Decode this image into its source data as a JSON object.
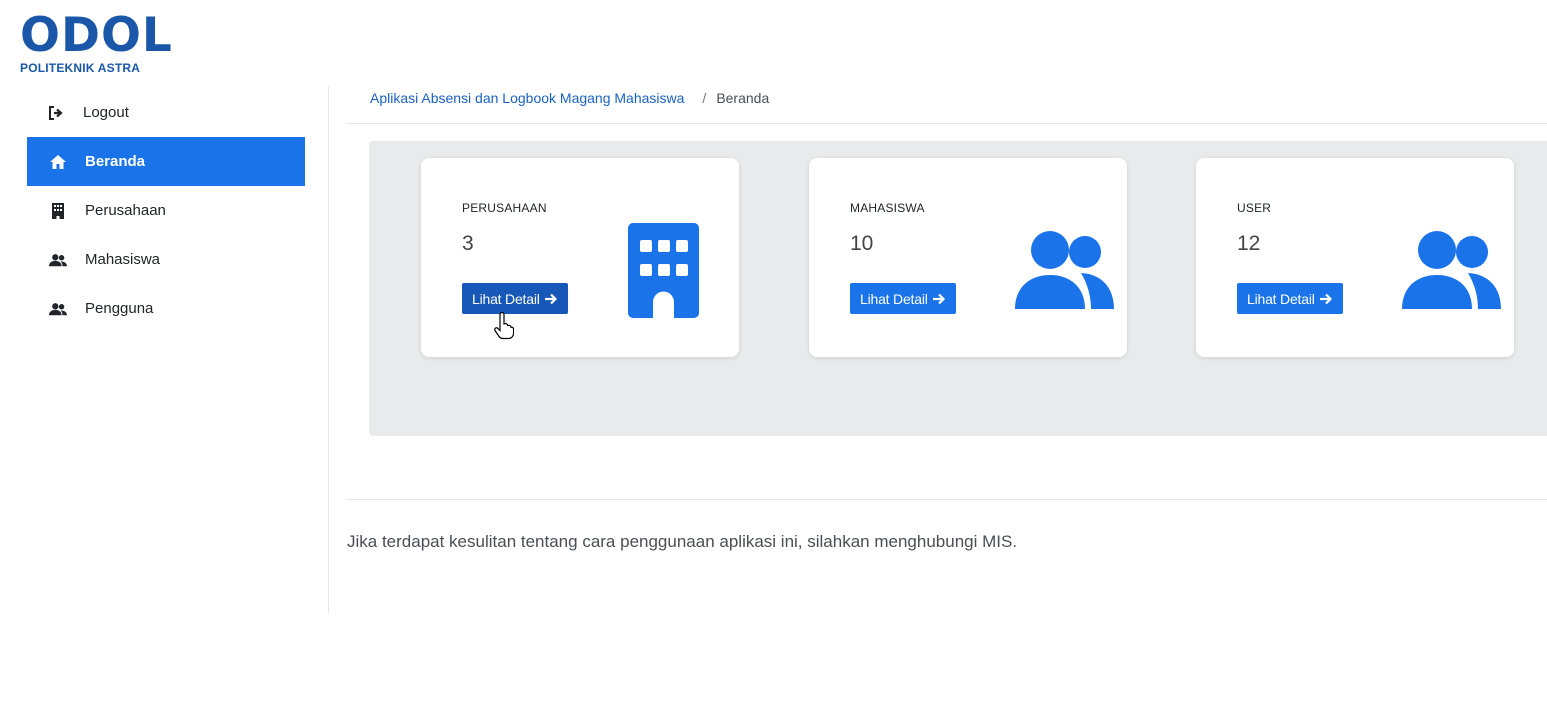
{
  "logo": {
    "title": "ODOL",
    "subtitle": "POLITEKNIK ASTRA"
  },
  "sidebar": {
    "items": [
      {
        "label": "Logout",
        "icon": "logout-icon"
      },
      {
        "label": "Beranda",
        "icon": "home-icon",
        "active": true
      },
      {
        "label": "Perusahaan",
        "icon": "building-icon"
      },
      {
        "label": "Mahasiswa",
        "icon": "users-icon"
      },
      {
        "label": "Pengguna",
        "icon": "users-icon"
      }
    ]
  },
  "breadcrumb": {
    "app": "Aplikasi Absensi dan Logbook Magang Mahasiswa",
    "separator": "/",
    "current": "Beranda"
  },
  "cards": [
    {
      "label": "PERUSAHAAN",
      "value": "3",
      "button": "Lihat Detail",
      "icon": "building-icon"
    },
    {
      "label": "MAHASISWA",
      "value": "10",
      "button": "Lihat Detail",
      "icon": "users-icon"
    },
    {
      "label": "USER",
      "value": "12",
      "button": "Lihat Detail",
      "icon": "users-icon"
    }
  ],
  "footer": {
    "text": "Jika terdapat kesulitan tentang cara penggunaan aplikasi ini, silahkan menghubungi MIS."
  },
  "colors": {
    "primary": "#1a73e8",
    "brand": "#1b57a8",
    "panel_bg": "#e9eaec"
  }
}
